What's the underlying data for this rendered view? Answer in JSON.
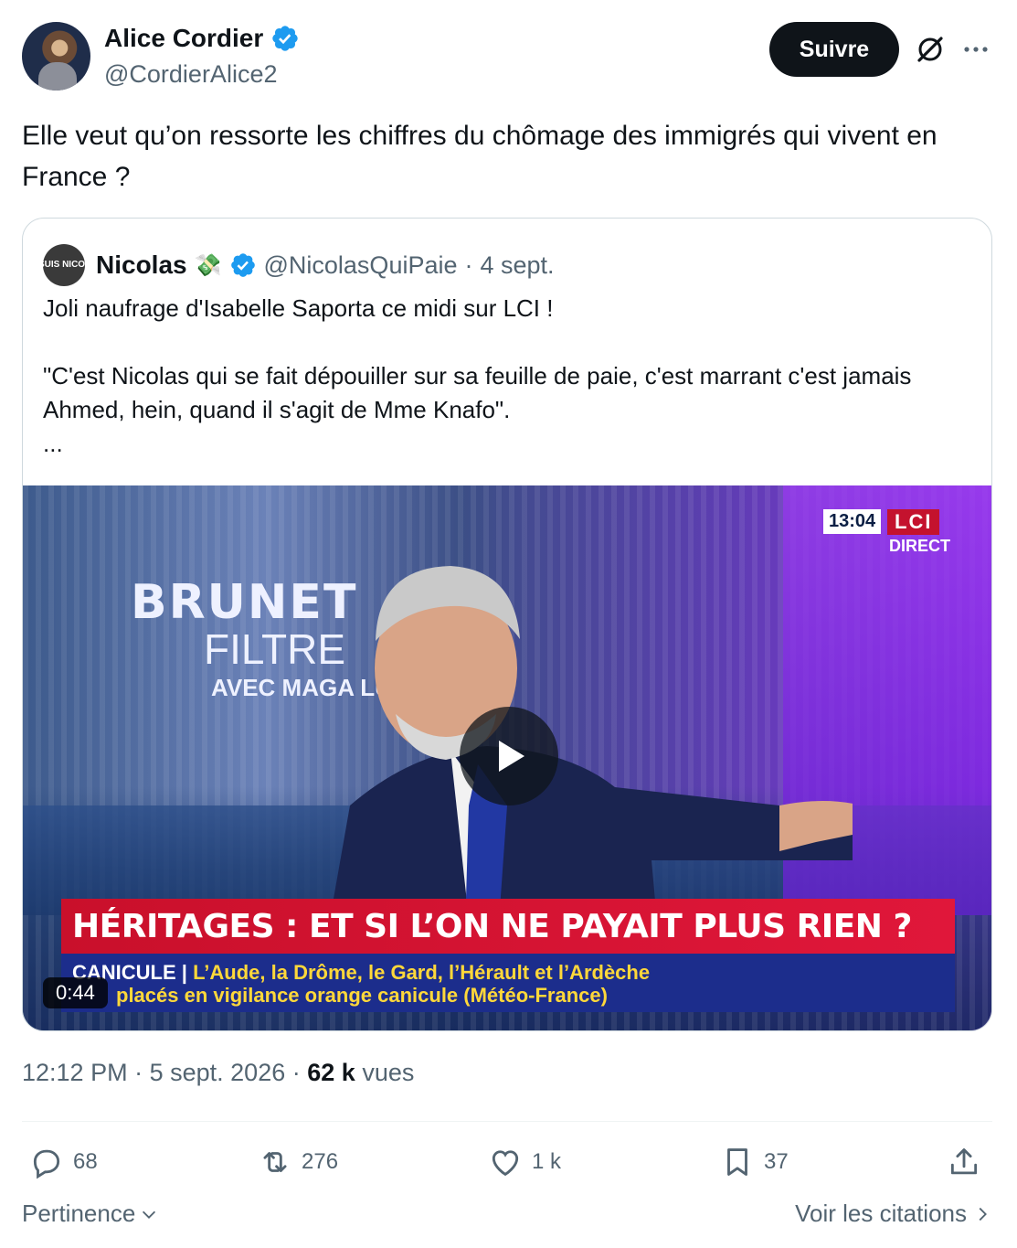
{
  "author": {
    "name": "Alice Cordier",
    "handle": "@CordierAlice2",
    "verified": true,
    "follow_label": "Suivre"
  },
  "tweet": {
    "text": "Elle veut qu’on ressorte les chiffres du chômage des immigrés qui vivent en France ?"
  },
  "quoted": {
    "avatar_text": "JE SUIS NICOLAS",
    "name": "Nicolas",
    "emoji": "💸",
    "handle": "@NicolasQuiPaie",
    "separator": "·",
    "date": "4 sept.",
    "line1": "Joli naufrage d'Isabelle Saporta ce midi sur LCI !",
    "line2": "\"C'est Nicolas qui se fait dépouiller sur sa feuille de paie, c'est marrant c'est jamais Ahmed, hein, quand il s'agit de Mme Knafo\".",
    "ellipsis": "...",
    "video": {
      "show_title_1": "BRUNET",
      "show_title_2": "FILTRE",
      "show_title_3": "AVEC MAGA LUNE",
      "clock": "13:04",
      "channel": "LCI",
      "live": "DIRECT",
      "headline": "HÉRITAGES : ET SI L’ON NE PAYAIT PLUS RIEN ?",
      "ticker_tag": "CANICULE |",
      "ticker_line1": "L’Aude, la Drôme, le Gard, l’Hérault et l’Ardèche",
      "ticker_line2": "placés en vigilance orange canicule (Météo-France)",
      "duration": "0:44"
    }
  },
  "meta": {
    "time": "12:12 PM",
    "sep1": "·",
    "date": "5 sept. 2026",
    "sep2": "·",
    "views_count": "62 k",
    "views_label": "vues"
  },
  "actions": {
    "replies": "68",
    "reposts": "276",
    "likes": "1 k",
    "bookmarks": "37"
  },
  "footer": {
    "sort_label": "Pertinence",
    "quotes_label": "Voir les citations"
  },
  "colors": {
    "text": "#0f1419",
    "secondary": "#536471",
    "verified": "#1d9bf0",
    "border": "#cfd9de"
  }
}
